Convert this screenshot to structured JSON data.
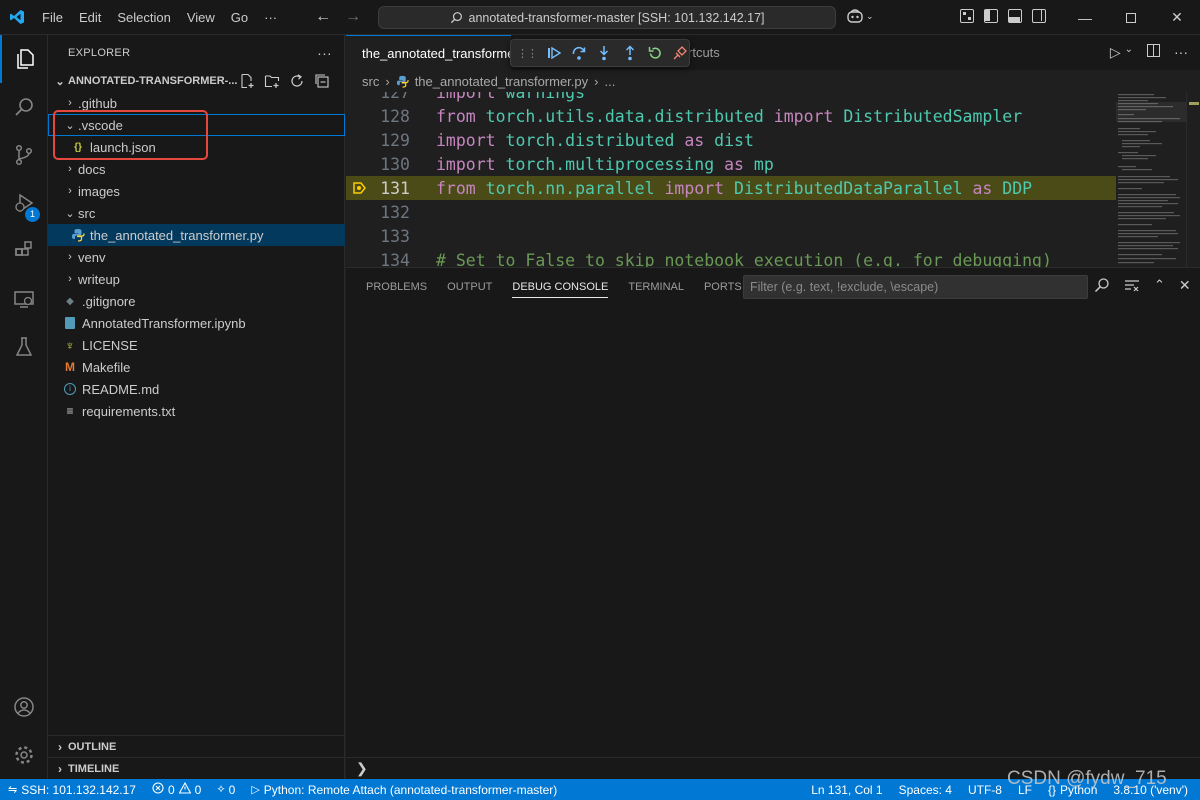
{
  "titlebar": {
    "menu": [
      "File",
      "Edit",
      "Selection",
      "View",
      "Go",
      "···"
    ],
    "command_center": "annotated-transformer-master [SSH: 101.132.142.17]"
  },
  "activity": {
    "debug_badge": "1"
  },
  "sidebar": {
    "header": "EXPLORER",
    "header_more": "···",
    "folder": "ANNOTATED-TRANSFORMER-...",
    "items": [
      {
        "label": ".github",
        "kind": "folder",
        "state": "collapsed"
      },
      {
        "label": ".vscode",
        "kind": "folder",
        "state": "expanded"
      },
      {
        "label": "launch.json",
        "kind": "json"
      },
      {
        "label": "docs",
        "kind": "folder",
        "state": "collapsed"
      },
      {
        "label": "images",
        "kind": "folder",
        "state": "collapsed"
      },
      {
        "label": "src",
        "kind": "folder",
        "state": "expanded"
      },
      {
        "label": "the_annotated_transformer.py",
        "kind": "python"
      },
      {
        "label": "venv",
        "kind": "folder",
        "state": "collapsed"
      },
      {
        "label": "writeup",
        "kind": "folder",
        "state": "collapsed"
      },
      {
        "label": ".gitignore",
        "kind": "git"
      },
      {
        "label": "AnnotatedTransformer.ipynb",
        "kind": "notebook"
      },
      {
        "label": "LICENSE",
        "kind": "license"
      },
      {
        "label": "Makefile",
        "kind": "makefile"
      },
      {
        "label": "README.md",
        "kind": "info"
      },
      {
        "label": "requirements.txt",
        "kind": "text"
      }
    ],
    "outline": "OUTLINE",
    "timeline": "TIMELINE"
  },
  "editor": {
    "tab_label": "the_annotated_transformer.py",
    "ghost_tab": "rtcuts",
    "breadcrumb": [
      "src",
      "the_annotated_transformer.py",
      "..."
    ],
    "lines": [
      {
        "n": "127",
        "tokens": [
          [
            "kw",
            "import "
          ],
          [
            "mod",
            "warnings"
          ]
        ]
      },
      {
        "n": "128",
        "tokens": [
          [
            "kw",
            "from "
          ],
          [
            "mod",
            "torch.utils.data.distributed "
          ],
          [
            "kw",
            "import "
          ],
          [
            "mod",
            "DistributedSampler"
          ]
        ]
      },
      {
        "n": "129",
        "tokens": [
          [
            "kw",
            "import "
          ],
          [
            "mod",
            "torch.distributed "
          ],
          [
            "kw",
            "as "
          ],
          [
            "mod",
            "dist"
          ]
        ]
      },
      {
        "n": "130",
        "tokens": [
          [
            "kw",
            "import "
          ],
          [
            "mod",
            "torch.multiprocessing "
          ],
          [
            "kw",
            "as "
          ],
          [
            "mod",
            "mp"
          ]
        ]
      },
      {
        "n": "131",
        "tokens": [
          [
            "kw",
            "from "
          ],
          [
            "mod",
            "torch.nn.parallel "
          ],
          [
            "kw",
            "import "
          ],
          [
            "mod",
            "DistributedDataParallel "
          ],
          [
            "kw",
            "as "
          ],
          [
            "mod",
            "DDP"
          ]
        ]
      },
      {
        "n": "132",
        "tokens": []
      },
      {
        "n": "133",
        "tokens": []
      },
      {
        "n": "134",
        "tokens": [
          [
            "cmt",
            "# Set to False to skip notebook execution (e.g. for debugging)"
          ]
        ]
      }
    ],
    "current_line": "131"
  },
  "panel": {
    "tabs": [
      "PROBLEMS",
      "OUTPUT",
      "DEBUG CONSOLE",
      "TERMINAL",
      "PORTS"
    ],
    "active_tab": "DEBUG CONSOLE",
    "filter_placeholder": "Filter (e.g. text, !exclude, \\escape)",
    "prompt": "❯"
  },
  "statusbar": {
    "remote": "SSH: 101.132.142.17",
    "errors": "0",
    "warnings": "0",
    "ports": "0",
    "debug_target": "Python: Remote Attach (annotated-transformer-master)",
    "position": "Ln 131, Col 1",
    "spaces": "Spaces: 4",
    "encoding": "UTF-8",
    "eol": "LF",
    "language": "Python",
    "interpreter": "3.8.10 ('venv')"
  },
  "watermark": "CSDN @fydw_715",
  "colors": {
    "accent": "#0078d4",
    "highlight_box": "#e5483d",
    "current_line": "#4b4b18"
  }
}
